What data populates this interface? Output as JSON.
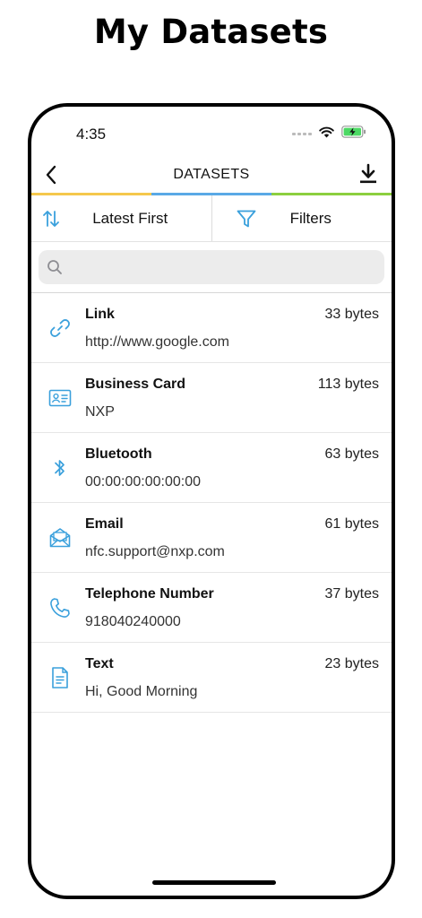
{
  "page": {
    "headline": "My Datasets"
  },
  "status_bar": {
    "time": "4:35",
    "icons": [
      "signal-dots",
      "wifi-icon",
      "battery-charging-icon"
    ]
  },
  "navbar": {
    "title": "DATASETS",
    "back_icon": "back-chevron-icon",
    "action_icon": "download-icon"
  },
  "accent_colors": [
    "#f5c84c",
    "#5aa9e6",
    "#8ccf3f"
  ],
  "sortbar": {
    "sort": {
      "label": "Latest First",
      "icon": "sort-arrows-icon"
    },
    "filter": {
      "label": "Filters",
      "icon": "filter-icon"
    }
  },
  "search": {
    "placeholder": "",
    "value": ""
  },
  "icon_color": "#3aa0dc",
  "datasets": [
    {
      "type": "link",
      "icon": "link-icon",
      "title": "Link",
      "subtitle": "http://www.google.com",
      "size": "33 bytes"
    },
    {
      "type": "business-card",
      "icon": "business-card-icon",
      "title": "Business Card",
      "subtitle": "NXP",
      "size": "113 bytes"
    },
    {
      "type": "bluetooth",
      "icon": "bluetooth-icon",
      "title": "Bluetooth",
      "subtitle": "00:00:00:00:00:00",
      "size": "63 bytes"
    },
    {
      "type": "email",
      "icon": "email-icon",
      "title": "Email",
      "subtitle": "nfc.support@nxp.com",
      "size": "61 bytes"
    },
    {
      "type": "telephone",
      "icon": "phone-icon",
      "title": "Telephone Number",
      "subtitle": "918040240000",
      "size": "37 bytes"
    },
    {
      "type": "text",
      "icon": "document-icon",
      "title": "Text",
      "subtitle": "Hi, Good Morning",
      "size": "23 bytes"
    }
  ]
}
